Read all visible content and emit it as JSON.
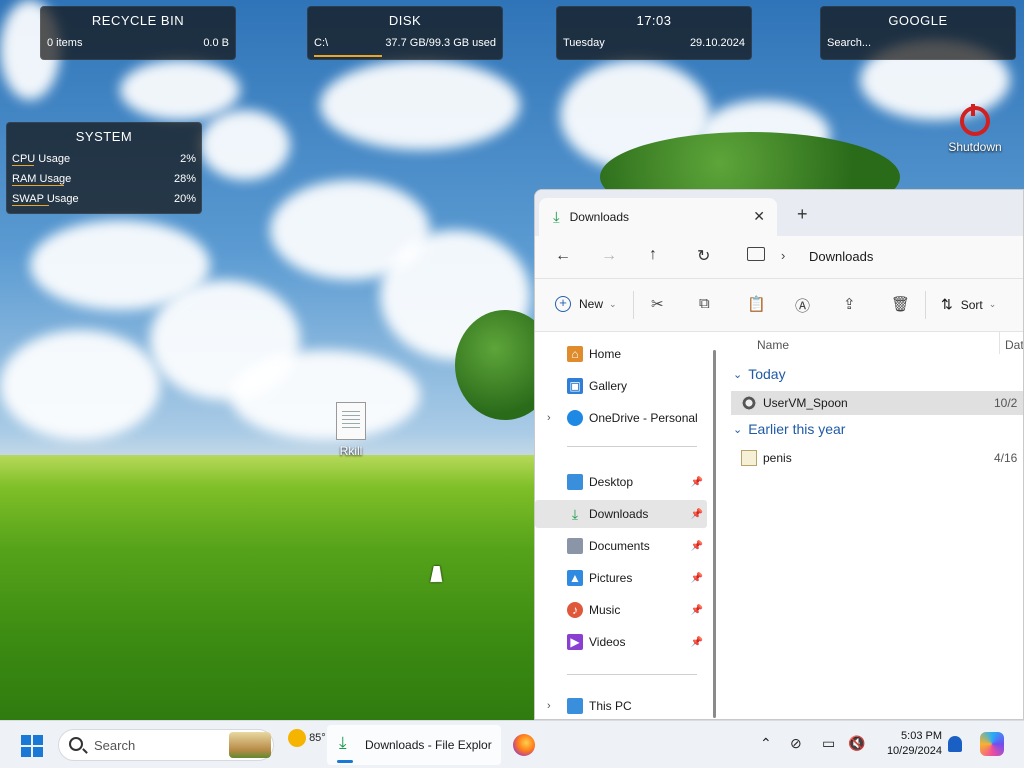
{
  "widgets": {
    "recycle": {
      "title": "RECYCLE BIN",
      "items": "0 items",
      "size": "0.0 B"
    },
    "disk": {
      "title": "DISK",
      "drive": "C:\\",
      "usage": "37.7 GB/99.3 GB used",
      "fraction_used": 0.38
    },
    "clock": {
      "time": "17:03",
      "day": "Tuesday",
      "date": "29.10.2024"
    },
    "google": {
      "title": "GOOGLE",
      "search_placeholder": "Search..."
    },
    "system": {
      "title": "SYSTEM",
      "rows": [
        {
          "label": "CPU Usage",
          "value": "2%",
          "fraction": 0.02
        },
        {
          "label": "RAM Usage",
          "value": "28%",
          "fraction": 0.28
        },
        {
          "label": "SWAP Usage",
          "value": "20%",
          "fraction": 0.2
        }
      ]
    }
  },
  "desktop_icons": {
    "rkill": "Rkill",
    "shutdown": "Shutdown"
  },
  "explorer": {
    "tab_title": "Downloads",
    "breadcrumb": "Downloads",
    "toolbar": {
      "new_label": "New",
      "sort_label": "Sort"
    },
    "nav": {
      "home": "Home",
      "gallery": "Gallery",
      "onedrive": "OneDrive - Personal",
      "desktop": "Desktop",
      "downloads": "Downloads",
      "documents": "Documents",
      "pictures": "Pictures",
      "music": "Music",
      "videos": "Videos",
      "thispc": "This PC"
    },
    "columns": {
      "name": "Name",
      "date": "Dat"
    },
    "groups": {
      "today": "Today",
      "earlier": "Earlier this year"
    },
    "files": [
      {
        "name": "UserVM_Spoon",
        "date": "10/2"
      },
      {
        "name": "penis",
        "date": "4/16"
      }
    ]
  },
  "taskbar": {
    "search_label": "Search",
    "weather_temp": "85°",
    "app_label": "Downloads - File Explor",
    "time": "5:03 PM",
    "date": "10/29/2024"
  },
  "colors": {
    "accent": "#1a78d6",
    "downloads_green": "#1a9b4d",
    "group_blue": "#1f5aa6"
  }
}
